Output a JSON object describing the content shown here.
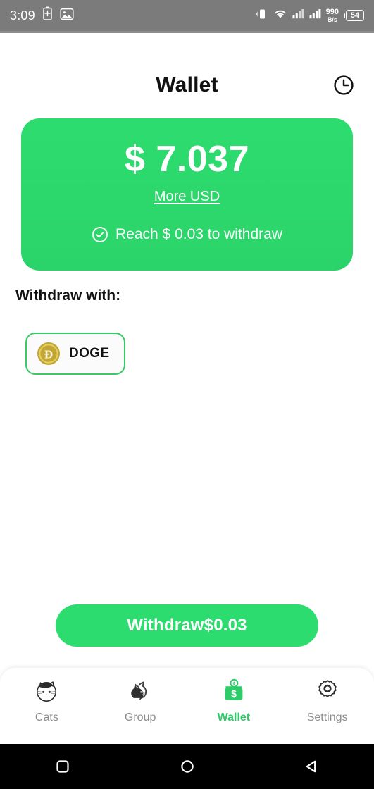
{
  "statusbar": {
    "time": "3:09",
    "battery_percent": "54",
    "network_speed": "990",
    "network_speed_unit": "B/s",
    "icons": [
      "battery-saver-icon",
      "image-icon",
      "vibrate-icon",
      "wifi-icon",
      "signal-icon-1",
      "signal-icon-2"
    ],
    "background_color": "#7b7b7b"
  },
  "header": {
    "title": "Wallet",
    "action_icon": "clock-history-icon"
  },
  "balance": {
    "amount": "$ 7.037",
    "more_link": "More USD",
    "reach_text": "Reach $ 0.03  to withdraw",
    "card_color": "#2ddc6e"
  },
  "withdraw_section": {
    "label": "Withdraw with:",
    "methods": [
      {
        "label": "DOGE",
        "icon": "doge-coin-icon",
        "selected": true,
        "accent": "#33cc66",
        "coin_color": "#c2a633"
      }
    ]
  },
  "withdraw_button": {
    "label": "Withdraw$0.03",
    "color": "#2ddc6e"
  },
  "bottom_nav": {
    "active_color": "#2ecc68",
    "inactive_color": "#8c8c8c",
    "items": [
      {
        "label": "Cats",
        "icon": "cat-face-icon",
        "active": false
      },
      {
        "label": "Group",
        "icon": "cat-group-icon",
        "active": false
      },
      {
        "label": "Wallet",
        "icon": "wallet-icon",
        "active": true
      },
      {
        "label": "Settings",
        "icon": "gear-icon",
        "active": false
      }
    ]
  },
  "android_nav": {
    "buttons": [
      "recents-square-icon",
      "home-circle-icon",
      "back-triangle-icon"
    ]
  }
}
